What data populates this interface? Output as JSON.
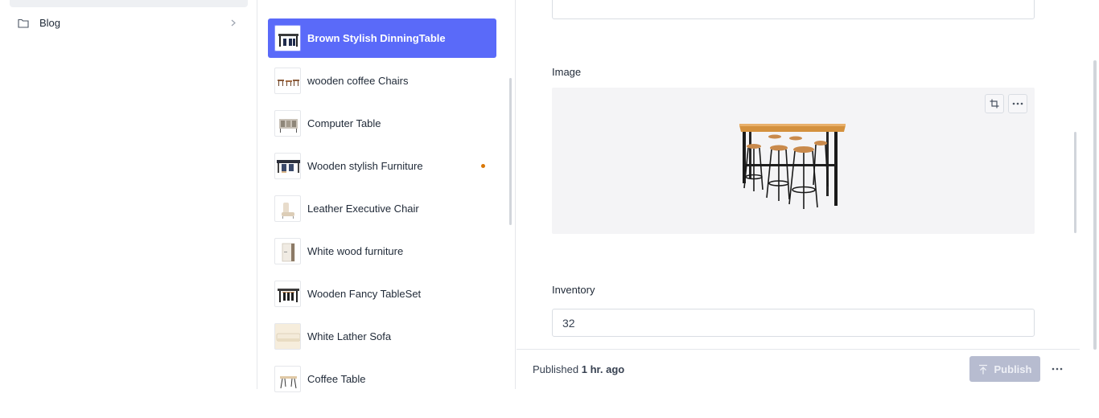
{
  "structure": {
    "items": [
      {
        "label": "Blog",
        "icon": "folder-icon"
      }
    ]
  },
  "documents": [
    {
      "title": "Brown Stylish DinningTable",
      "selected": true,
      "thumb": "bar-table-thumbnail"
    },
    {
      "title": "wooden coffee Chairs",
      "thumb": "coffee-chairs-thumbnail"
    },
    {
      "title": "Computer Table",
      "thumb": "computer-table-thumbnail"
    },
    {
      "title": "Wooden stylish Furniture",
      "unpublished_changes": true,
      "thumb": "stylish-furniture-thumbnail"
    },
    {
      "title": "Leather Executive Chair",
      "thumb": "executive-chair-thumbnail"
    },
    {
      "title": "White wood furniture",
      "thumb": "white-furniture-thumbnail"
    },
    {
      "title": "Wooden Fancy TableSet",
      "thumb": "fancy-tableset-thumbnail"
    },
    {
      "title": "White Lather Sofa",
      "thumb": "sofa-thumbnail"
    },
    {
      "title": "Coffee Table",
      "thumb": "coffee-table-thumbnail"
    }
  ],
  "editor": {
    "image": {
      "label": "Image",
      "crop_icon": "crop-icon",
      "menu_icon": "ellipsis-icon",
      "preview": "bar-table-with-stools-image"
    },
    "inventory": {
      "label": "Inventory",
      "value": "32"
    }
  },
  "footer": {
    "status_prefix": "Published",
    "status_time": "1 hr. ago",
    "publish_label": "Publish",
    "publish_icon": "publish-arrow-icon",
    "more_icon": "ellipsis-icon"
  },
  "colors": {
    "accent": "#5a6af9",
    "publish_disabled": "#b7bcd0",
    "changes_dot": "#d97706"
  }
}
